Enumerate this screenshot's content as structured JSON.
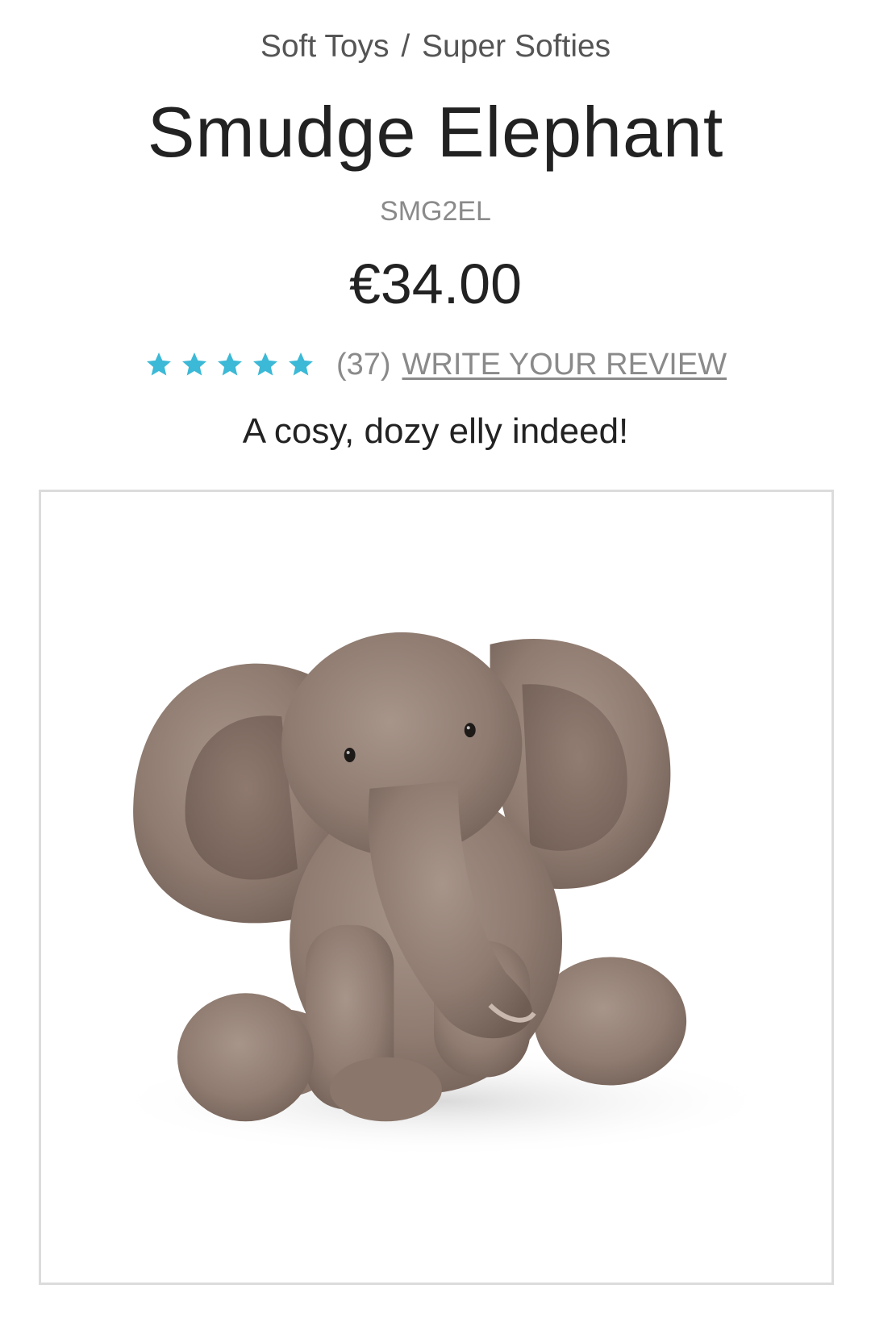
{
  "breadcrumb": {
    "category": "Soft Toys",
    "separator": "/",
    "subcategory": "Super Softies"
  },
  "product": {
    "title": "Smudge Elephant",
    "sku": "SMG2EL",
    "price": "€34.00",
    "tagline": "A cosy, dozy elly indeed!",
    "image_alt": "Smudge Elephant plush toy"
  },
  "rating": {
    "stars": 5,
    "max_stars": 5,
    "count_label": "(37)",
    "write_review_label": "WRITE YOUR REVIEW",
    "star_color": "#3bb9d6"
  },
  "icons": {
    "star": "star-icon"
  }
}
